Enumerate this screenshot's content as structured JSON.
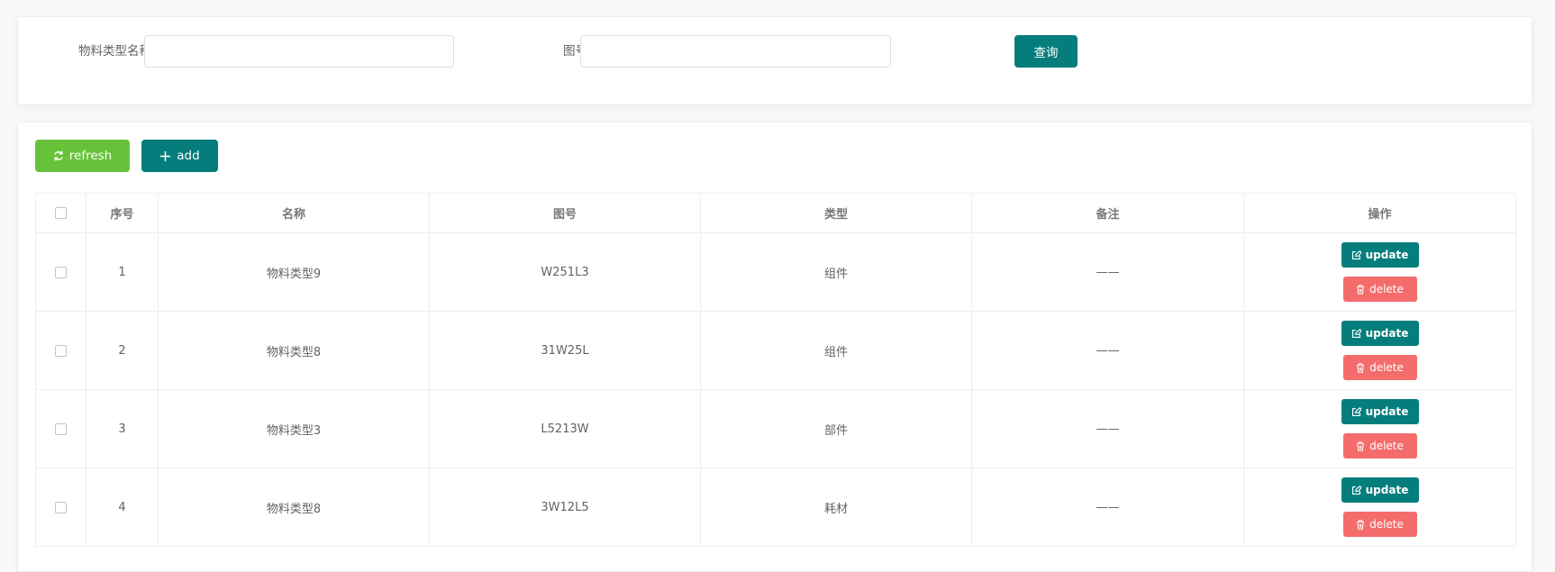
{
  "search": {
    "material_type_label": "物料类型名称",
    "material_type_value": "",
    "material_type_placeholder": "",
    "drawing_no_label": "图号",
    "drawing_no_value": "",
    "drawing_no_placeholder": "",
    "query_label": "查询"
  },
  "toolbar": {
    "refresh_label": "refresh",
    "add_label": "add"
  },
  "table": {
    "headers": [
      "序号",
      "名称",
      "图号",
      "类型",
      "备注",
      "操作"
    ],
    "rows": [
      {
        "index": "1",
        "name": "物料类型9",
        "drawing_no": "W251L3",
        "type": "组件",
        "remark": "——"
      },
      {
        "index": "2",
        "name": "物料类型8",
        "drawing_no": "31W25L",
        "type": "组件",
        "remark": "——"
      },
      {
        "index": "3",
        "name": "物料类型3",
        "drawing_no": "L5213W",
        "type": "部件",
        "remark": "——"
      },
      {
        "index": "4",
        "name": "物料类型8",
        "drawing_no": "3W12L5",
        "type": "耗材",
        "remark": "——"
      }
    ],
    "update_label": "update",
    "delete_label": "delete"
  },
  "colors": {
    "primary": "#057d7d",
    "success": "#67c23a",
    "danger": "#f56c6c"
  }
}
